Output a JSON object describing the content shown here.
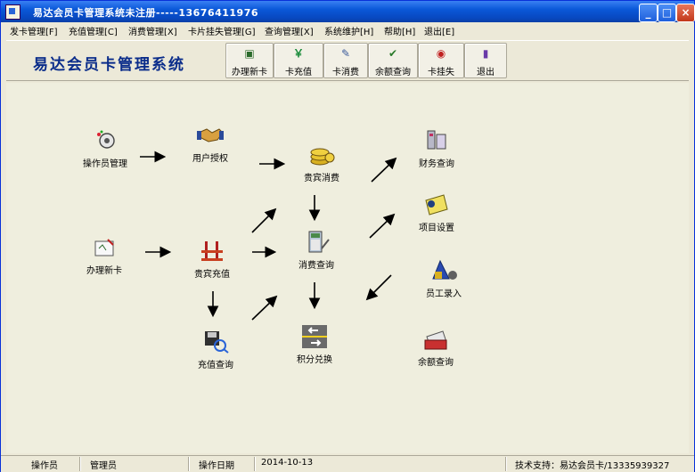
{
  "window": {
    "title": "易达会员卡管理系统未注册-----13676411976",
    "controls": [
      "_",
      "□",
      "×"
    ]
  },
  "menubar": [
    "发卡管理[F]",
    "充值管理[C]",
    "消费管理[X]",
    "卡片挂失管理[G]",
    "查询管理[X]",
    "系统维护[H]",
    "帮助[H]",
    "退出[E]"
  ],
  "toolbar": {
    "logo": "易达会员卡管理系统",
    "buttons": [
      {
        "label": "办理新卡",
        "icon": "new-card-icon",
        "glyph": "▣"
      },
      {
        "label": "卡充值",
        "icon": "yen-icon",
        "glyph": "￥"
      },
      {
        "label": "卡消费",
        "icon": "consume-icon",
        "glyph": "✎"
      },
      {
        "label": "余额查询",
        "icon": "balance-query-icon",
        "glyph": "✔"
      },
      {
        "label": "卡挂失",
        "icon": "report-loss-icon",
        "glyph": "◉"
      },
      {
        "label": "退出",
        "icon": "exit-icon",
        "glyph": "▮"
      }
    ]
  },
  "flow": {
    "nodes": {
      "operator": "操作员管理",
      "auth": "用户授权",
      "vip_consume": "贵宾消费",
      "finance": "财务查询",
      "new_card": "办理新卡",
      "vip_recharge": "贵宾充值",
      "consume_query": "消费查询",
      "item_setup": "项目设置",
      "staff_entry": "员工录入",
      "recharge_query": "充值查询",
      "points": "积分兑换",
      "balance_query": "余额查询"
    }
  },
  "status": {
    "operator_label": "操作员",
    "operator_value": "管理员",
    "date_label": "操作日期",
    "date_value": "2014-10-13",
    "support": "技术支持：易达会员卡/13335939327"
  }
}
